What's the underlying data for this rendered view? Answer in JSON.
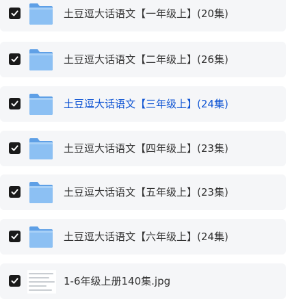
{
  "colors": {
    "row_background": "#f5f6f8",
    "checkbox_fill": "#1a1a1a",
    "text": "#333333",
    "hover_link": "#0d53d3",
    "folder_blue": "#7ab5f0"
  },
  "files": [
    {
      "name": "土豆逗大话语文【一年级上】(20集)",
      "icon": "folder-icon",
      "checked": true
    },
    {
      "name": "土豆逗大话语文【二年级上】(26集)",
      "icon": "folder-icon",
      "checked": true
    },
    {
      "name": "土豆逗大话语文【三年级上】(24集)",
      "icon": "folder-icon",
      "checked": true,
      "hovered": true
    },
    {
      "name": "土豆逗大话语文【四年级上】(23集)",
      "icon": "folder-icon",
      "checked": true
    },
    {
      "name": "土豆逗大话语文【五年级上】(23集)",
      "icon": "folder-icon",
      "checked": true
    },
    {
      "name": "土豆逗大话语文【六年级上】(24集)",
      "icon": "folder-icon",
      "checked": true
    },
    {
      "name": "1-6年级上册140集.jpg",
      "icon": "image-thumbnail-icon",
      "checked": true
    }
  ]
}
